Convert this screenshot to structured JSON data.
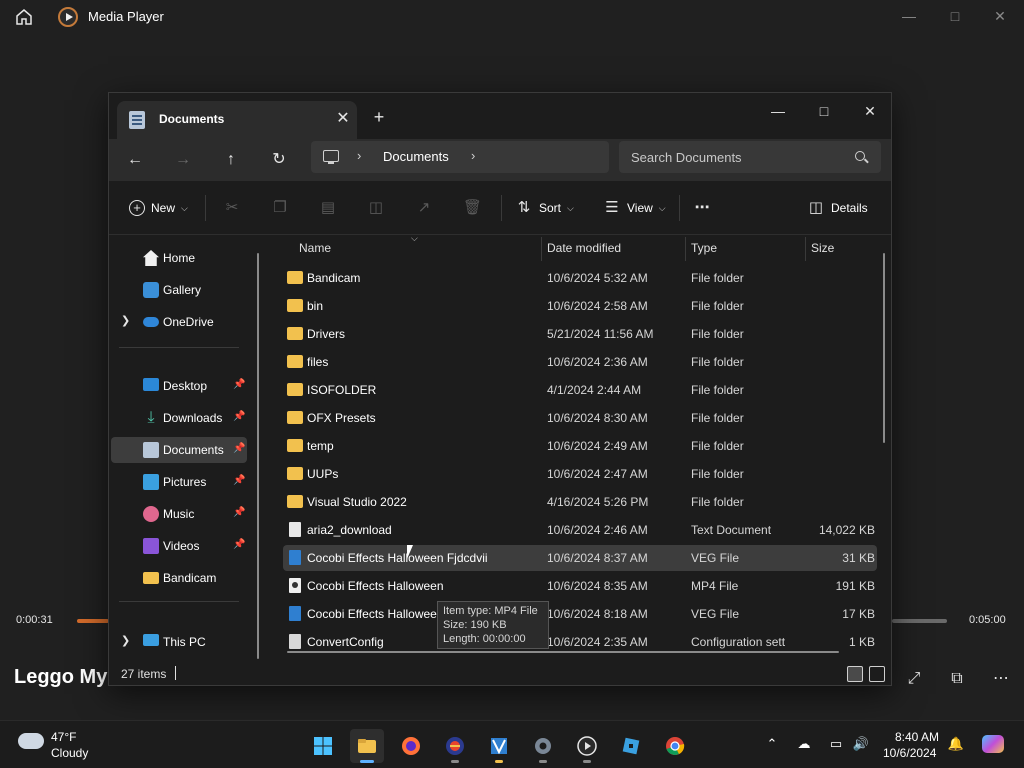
{
  "media_player": {
    "title": "Media Player",
    "time_elapsed": "0:00:31",
    "time_total": "0:05:00",
    "song_title": "Leggo My"
  },
  "explorer": {
    "tab_title": "Documents",
    "breadcrumb": "Documents",
    "search_placeholder": "Search Documents",
    "toolbar": {
      "new_label": "New",
      "sort_label": "Sort",
      "view_label": "View",
      "details_label": "Details"
    },
    "nav": {
      "home": "Home",
      "gallery": "Gallery",
      "onedrive": "OneDrive",
      "desktop": "Desktop",
      "downloads": "Downloads",
      "documents": "Documents",
      "pictures": "Pictures",
      "music": "Music",
      "videos": "Videos",
      "bandicam": "Bandicam",
      "thispc": "This PC"
    },
    "columns": {
      "name": "Name",
      "date": "Date modified",
      "type": "Type",
      "size": "Size"
    },
    "files": [
      {
        "name": "Bandicam",
        "date": "10/6/2024 5:32 AM",
        "type": "File folder",
        "size": "",
        "icon": "folder-icon"
      },
      {
        "name": "bin",
        "date": "10/6/2024 2:58 AM",
        "type": "File folder",
        "size": "",
        "icon": "folder-icon"
      },
      {
        "name": "Drivers",
        "date": "5/21/2024 11:56 AM",
        "type": "File folder",
        "size": "",
        "icon": "folder-icon"
      },
      {
        "name": "files",
        "date": "10/6/2024 2:36 AM",
        "type": "File folder",
        "size": "",
        "icon": "folder-icon"
      },
      {
        "name": "ISOFOLDER",
        "date": "4/1/2024 2:44 AM",
        "type": "File folder",
        "size": "",
        "icon": "folder-icon"
      },
      {
        "name": "OFX Presets",
        "date": "10/6/2024 8:30 AM",
        "type": "File folder",
        "size": "",
        "icon": "folder-icon"
      },
      {
        "name": "temp",
        "date": "10/6/2024 2:49 AM",
        "type": "File folder",
        "size": "",
        "icon": "folder-icon"
      },
      {
        "name": "UUPs",
        "date": "10/6/2024 2:47 AM",
        "type": "File folder",
        "size": "",
        "icon": "folder-icon"
      },
      {
        "name": "Visual Studio 2022",
        "date": "4/16/2024 5:26 PM",
        "type": "File folder",
        "size": "",
        "icon": "folder-icon"
      },
      {
        "name": "aria2_download",
        "date": "10/6/2024 2:46 AM",
        "type": "Text Document",
        "size": "14,022 KB",
        "icon": "text-file-icon"
      },
      {
        "name": "Cocobi Effects Halloween Fjdcdvii",
        "date": "10/6/2024 8:37 AM",
        "type": "VEG File",
        "size": "31 KB",
        "icon": "veg-file-icon"
      },
      {
        "name": "Cocobi Effects Halloween",
        "date": "10/6/2024 8:35 AM",
        "type": "MP4 File",
        "size": "191 KB",
        "icon": "mp4-file-icon"
      },
      {
        "name": "Cocobi Effects Halloween",
        "date": "10/6/2024 8:18 AM",
        "type": "VEG File",
        "size": "17 KB",
        "icon": "veg-file-icon"
      },
      {
        "name": "ConvertConfig",
        "date": "10/6/2024 2:35 AM",
        "type": "Configuration sett",
        "size": "1 KB",
        "icon": "config-file-icon"
      }
    ],
    "tooltip": {
      "line1": "Item type: MP4 File",
      "line2": "Size: 190 KB",
      "line3": "Length: 00:00:00"
    },
    "status_count": "27 items"
  },
  "taskbar": {
    "weather_temp": "47°F",
    "weather_cond": "Cloudy",
    "clock_time": "8:40 AM",
    "clock_date": "10/6/2024"
  }
}
